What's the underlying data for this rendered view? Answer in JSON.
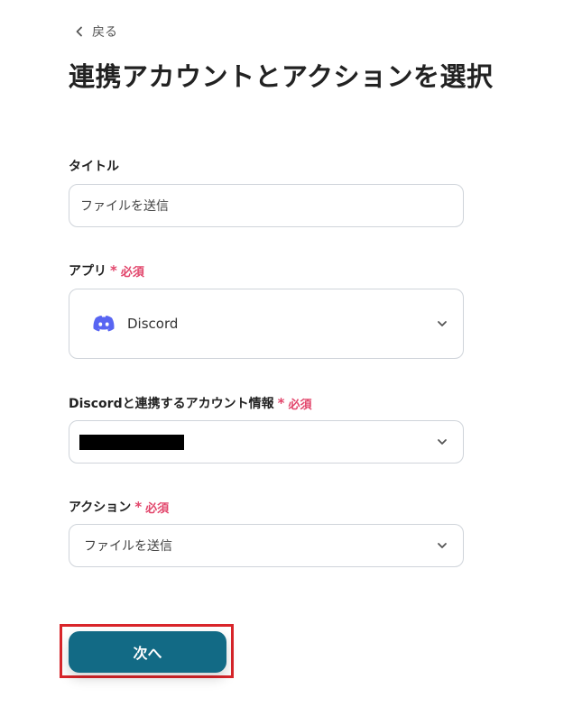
{
  "back": {
    "label": "戻る",
    "icon": "chevron-left-icon"
  },
  "page_title": "連携アカウントとアクションを選択",
  "required_text": "必須",
  "required_mark": "*",
  "required_color": "#e2456b",
  "title_field": {
    "label": "タイトル",
    "value": "ファイルを送信"
  },
  "app_field": {
    "label": "アプリ",
    "value": "Discord",
    "icon": "discord-logo-icon"
  },
  "account_field": {
    "label": "Discordと連携するアカウント情報",
    "value_redacted": true
  },
  "action_field": {
    "label": "アクション",
    "value": "ファイルを送信"
  },
  "next_button": {
    "label": "次へ",
    "color": "#126a85"
  },
  "highlight_color": "#d9252a"
}
